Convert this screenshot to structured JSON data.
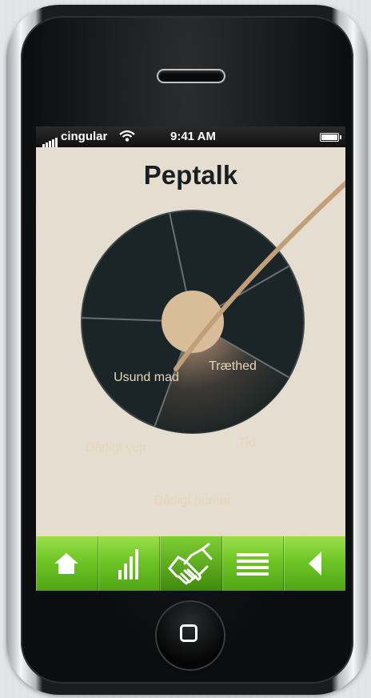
{
  "status_bar": {
    "carrier": "cingular",
    "time": "9:41 AM"
  },
  "app": {
    "title": "Peptalk"
  },
  "wheel": {
    "segments": [
      {
        "label": "Usund mad"
      },
      {
        "label": "Træthed"
      },
      {
        "label": "Tid"
      },
      {
        "label": "Dårligt humør",
        "selected": true
      },
      {
        "label": "Dårligt vejr"
      }
    ]
  },
  "toolbar": {
    "items": [
      {
        "icon": "home-icon"
      },
      {
        "icon": "bar-chart-icon"
      },
      {
        "icon": "handshake-icon",
        "active": true
      },
      {
        "icon": "list-icon"
      },
      {
        "icon": "back-arrow-icon"
      }
    ]
  },
  "colors": {
    "background": "#e4ddd0",
    "wheel": "#1b2426",
    "accent": "#d9bc9a",
    "toolbar_green": "#6fc526"
  }
}
